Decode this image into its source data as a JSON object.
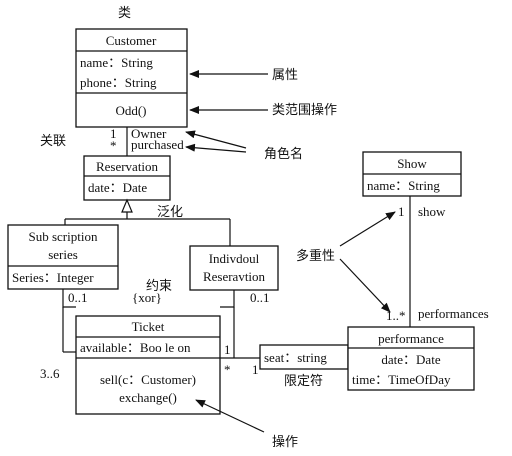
{
  "classes": {
    "customer": {
      "name": "Customer",
      "attr1": "name：String",
      "attr2": "phone：String",
      "op1": "Odd()"
    },
    "reservation": {
      "name": "Reservation",
      "attr1": "date：Date"
    },
    "subscription": {
      "name1": "Sub scription",
      "name2": "series",
      "attr1": "Series：Integer"
    },
    "individual": {
      "name1": "Indivdoul",
      "name2": "Reseravtion"
    },
    "ticket": {
      "name": "Ticket",
      "attr1": "available：Boo le on",
      "op1": "sell(c：Customer)",
      "op2": "exchange()"
    },
    "show": {
      "name": "Show",
      "attr1": "name：String"
    },
    "performance": {
      "name": "performance",
      "attr1": "date：Date",
      "attr2": "time：TimeOfDay"
    },
    "qualifier": {
      "text": "seat：string"
    }
  },
  "annotations": {
    "class_label": "类",
    "attribute_label": "属性",
    "class_op_label": "类范围操作",
    "association_label": "关联",
    "role_label": "角色名",
    "generalization_label": "泛化",
    "multiplicity_label": "多重性",
    "constraint_label": "约束",
    "qualifier_label": "限定符",
    "operation_label": "操作"
  },
  "multiplicities": {
    "owner_mult": "1",
    "purchased_mult": "*",
    "sub_mult": "0..1",
    "ind_mult": "0..1",
    "ticket_mult": "3..6",
    "ticket_right": "1",
    "ticket_star": "*",
    "qual_one": "1",
    "show_mult": "1",
    "perf_mult": "1..*"
  },
  "roles": {
    "owner": "Owner",
    "purchased": "purchased",
    "show": "show",
    "performances": "performances"
  },
  "constraint": "{xor}"
}
